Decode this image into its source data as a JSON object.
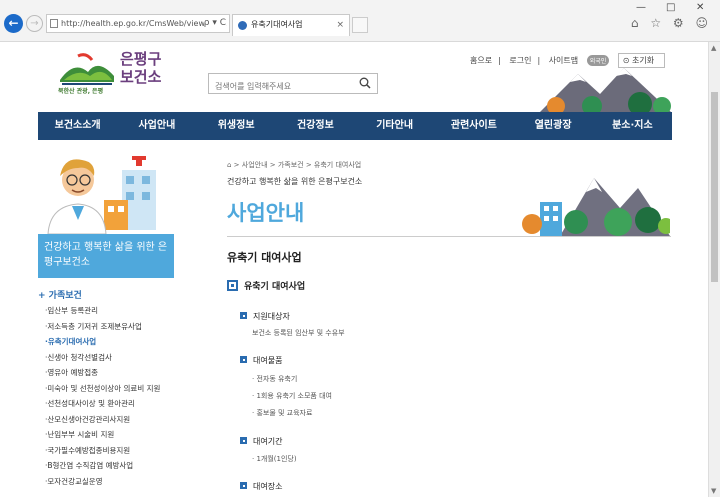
{
  "browser": {
    "url": "http://health.ep.go.kr/CmsWeb/viewPage.",
    "address_icons": "ρ ▾ C",
    "tab_title": "유축기대여사업",
    "tab_close": "×",
    "window_controls": [
      "—",
      "□",
      "✕"
    ],
    "tool_icons": "⌂ ☆ ⚙ ☺"
  },
  "header": {
    "logo_title": "은평구 보건소",
    "logo_sub": "북한산 관광, 은평",
    "search_placeholder": "검색어를 입력해주세요",
    "util_links": [
      "홈으로",
      "로그인",
      "사이트맵"
    ],
    "lang_badge": "외국인",
    "reset_label": "초기화"
  },
  "gnb": [
    "보건소소개",
    "사업안내",
    "위생정보",
    "건강정보",
    "기타안내",
    "관련사이트",
    "열린광장",
    "분소·지소"
  ],
  "sidebar": {
    "banner": "건강하고 행복한 삶을 위한 은평구보건소",
    "heading": "+ 가족보건",
    "items": [
      "·임산부 등록관리",
      "·저소득층 기저귀 조제분유사업",
      "·유축기대여사업",
      "·신생아 청각선별검사",
      "·영유아 예방접종",
      "·미숙아 및 선천성이상아 의료비 지원",
      "·선천성대사이상 및 환아관리",
      "·산모신생아건강관리사지원",
      "·난임부부 시술비 지원",
      "·국가필수예방접종비용지원",
      "·B형간염 수직감염 예방사업",
      "·모자건강교실운영"
    ],
    "active_index": 2
  },
  "main": {
    "breadcrumb": "⌂  >  사업안내  >  가족보건  >  유축기 대여사업",
    "tagline": "건강하고 행복한 삶을 위한 은평구보건소",
    "title": "사업안내",
    "sub_title": "유축기 대여사업",
    "section_title": "유축기 대여사업",
    "items": [
      {
        "head": "지원대상자",
        "lines": [
          "보건소 등록된 임산부 및 수유부"
        ]
      },
      {
        "head": "대여물품",
        "lines": [
          "· 전자동 유축기",
          "· 1회용 유축기 소모품 대여",
          "· 홍보물 및 교육자료"
        ]
      },
      {
        "head": "대여기간",
        "lines": [
          "· 1개월(1인당)"
        ]
      },
      {
        "head": "대여장소",
        "lines": []
      }
    ]
  },
  "colors": {
    "gnb_bg": "#1e4775",
    "accent": "#4fa8dc",
    "link": "#2a6cb0"
  }
}
